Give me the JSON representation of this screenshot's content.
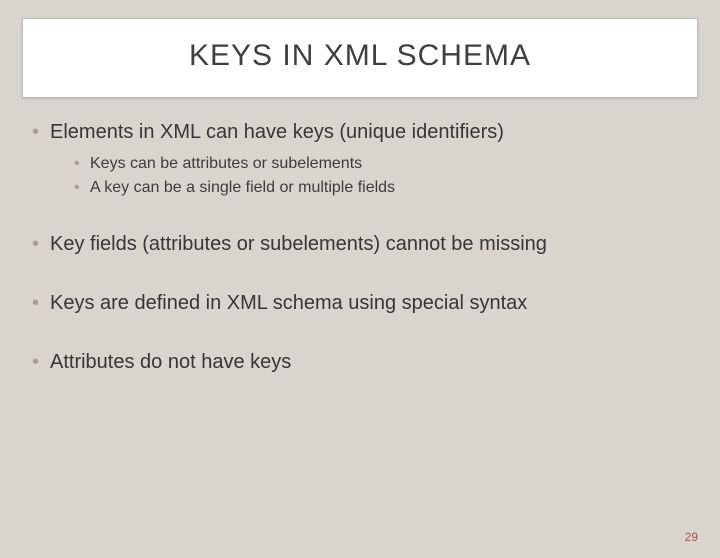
{
  "title": "KEYS IN XML SCHEMA",
  "bullets": {
    "b1": "Elements in XML can have keys (unique identifiers)",
    "b1_sub1": "Keys can be attributes or subelements",
    "b1_sub2": "A key can be a single field or multiple fields",
    "b2": "Key fields (attributes or subelements) cannot be missing",
    "b3": "Keys are defined in XML schema using special syntax",
    "b4": "Attributes do not have keys"
  },
  "page_number": "29"
}
